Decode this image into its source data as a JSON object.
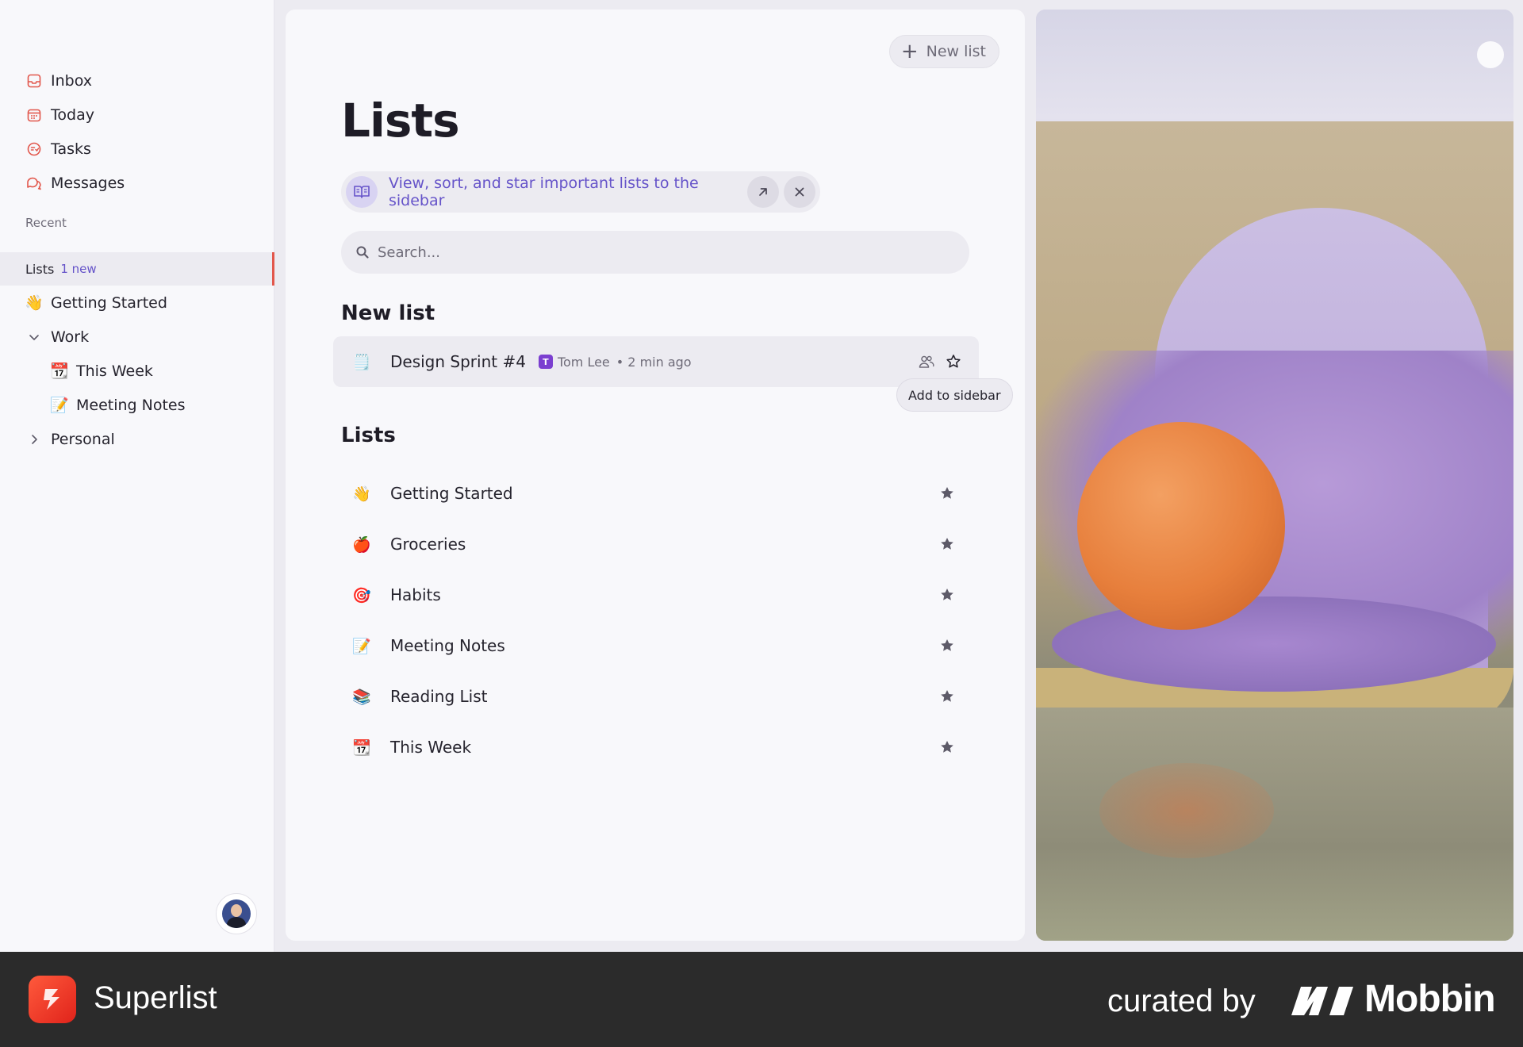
{
  "sidebar": {
    "nav": [
      {
        "label": "Inbox",
        "icon": "inbox-icon"
      },
      {
        "label": "Today",
        "icon": "calendar-icon"
      },
      {
        "label": "Tasks",
        "icon": "tasks-icon"
      },
      {
        "label": "Messages",
        "icon": "messages-icon"
      }
    ],
    "recent_label": "Recent",
    "lists_label": "Lists",
    "lists_badge": "1 new",
    "tree": [
      {
        "label": "Getting Started",
        "emoji": "👋"
      },
      {
        "label": "Work"
      },
      {
        "label": "This Week",
        "emoji": "📆"
      },
      {
        "label": "Meeting Notes",
        "emoji": "📝"
      },
      {
        "label": "Personal"
      }
    ]
  },
  "main": {
    "new_list_label": "New list",
    "title": "Lists",
    "hint": "View, sort, and star important lists to the sidebar",
    "search_placeholder": "Search...",
    "new_list_heading": "New list",
    "recent_item": {
      "emoji": "🗒️",
      "name": "Design Sprint #4",
      "user_initial": "T",
      "user": "Tom Lee",
      "time": "• 2 min ago"
    },
    "tooltip": "Add to sidebar",
    "lists_heading": "Lists",
    "lists": [
      {
        "emoji": "👋",
        "name": "Getting Started"
      },
      {
        "emoji": "🍎",
        "name": "Groceries"
      },
      {
        "emoji": "🎯",
        "name": "Habits"
      },
      {
        "emoji": "📝",
        "name": "Meeting Notes"
      },
      {
        "emoji": "📚",
        "name": "Reading List"
      },
      {
        "emoji": "📆",
        "name": "This Week"
      }
    ]
  },
  "footer": {
    "brand": "Superlist",
    "curated": "curated by",
    "mobbin": "Mobbin"
  },
  "colors": {
    "accent": "#6553c9",
    "nav_icon": "#e2574c",
    "footer_bg": "#2b2b2b"
  }
}
